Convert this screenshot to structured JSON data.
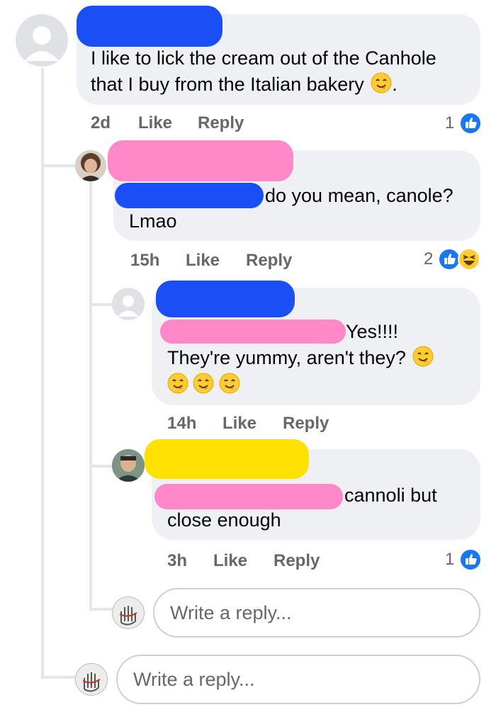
{
  "colors": {
    "bubble": "#eef0f3",
    "meta_text": "#65676b",
    "like_blue": "#1877f2",
    "redact_blue": "#1a4ff6",
    "redact_pink": "#ff88c8",
    "redact_yellow": "#ffe100"
  },
  "comments": [
    {
      "text_line1": "I like to lick the cream out of the Canhole",
      "text_line2": "that I buy from the Italian bakery",
      "text_line2_suffix": ".",
      "time": "2d",
      "like": "Like",
      "reply": "Reply",
      "reaction_count": "1",
      "reaction_icons": [
        "like-icon"
      ]
    },
    {
      "text_line1": "do you mean, canole?",
      "text_line2": "Lmao",
      "time": "15h",
      "like": "Like",
      "reply": "Reply",
      "reaction_count": "2",
      "reaction_icons": [
        "like-icon",
        "haha-icon"
      ]
    },
    {
      "text_line1": "Yes!!!!",
      "text_line2": "They're yummy, aren't they?",
      "time": "14h",
      "like": "Like",
      "reply": "Reply"
    },
    {
      "text_line1": "cannoli but",
      "text_line2": "close enough",
      "time": "3h",
      "like": "Like",
      "reply": "Reply",
      "reaction_count": "1",
      "reaction_icons": [
        "like-icon"
      ]
    }
  ],
  "reply_boxes": [
    {
      "placeholder": "Write a reply..."
    },
    {
      "placeholder": "Write a reply..."
    }
  ]
}
